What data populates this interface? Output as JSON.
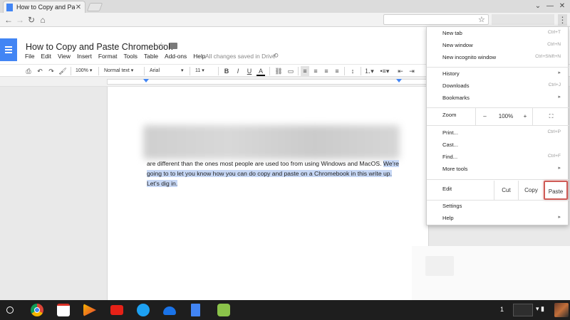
{
  "browser": {
    "tab_title": "How to Copy and Paste",
    "tab_close": "✕",
    "window_controls": [
      "⌄",
      "—",
      "✕"
    ],
    "nav_icons": [
      "back-arrow-icon",
      "forward-arrow-icon",
      "reload-icon",
      "home-icon"
    ],
    "menu_icon": "⋮"
  },
  "docs": {
    "title": "How to Copy and Paste Chromebook",
    "menu": [
      "File",
      "Edit",
      "View",
      "Insert",
      "Format",
      "Tools",
      "Table",
      "Add-ons",
      "Help"
    ],
    "save_status": "All changes saved in Drive",
    "toolbar": {
      "zoom": "100%",
      "style": "Normal text",
      "font": "Arial",
      "size": "11"
    },
    "body": {
      "plain": "are different than the ones most people are used too from using Windows and MacOS.",
      "highlight_1": "We're",
      "highlight_2": "going to to let you know how you can do copy and paste on a Chromebook in this write up.",
      "highlight_3": "Let's dig in."
    }
  },
  "chrome_menu": {
    "group1": [
      {
        "label": "New tab",
        "shortcut": "Ctrl+T"
      },
      {
        "label": "New window",
        "shortcut": "Ctrl+N"
      },
      {
        "label": "New incognito window",
        "shortcut": "Ctrl+Shift+N"
      }
    ],
    "group2": [
      {
        "label": "History",
        "arrow": "▸"
      },
      {
        "label": "Downloads",
        "shortcut": "Ctrl+J"
      },
      {
        "label": "Bookmarks",
        "arrow": "▸"
      }
    ],
    "zoom": {
      "label": "Zoom",
      "minus": "–",
      "value": "100%",
      "plus": "+",
      "fullscreen": "⛶"
    },
    "group3": [
      {
        "label": "Print...",
        "shortcut": "Ctrl+P"
      },
      {
        "label": "Cast..."
      },
      {
        "label": "Find...",
        "shortcut": "Ctrl+F"
      },
      {
        "label": "More tools",
        "arrow": "▸"
      }
    ],
    "edit": {
      "label": "Edit",
      "cut": "Cut",
      "copy": "Copy",
      "paste": "Paste"
    },
    "group4": [
      {
        "label": "Settings"
      },
      {
        "label": "Help",
        "arrow": "▸"
      }
    ]
  },
  "shelf": {
    "tray_number": "1",
    "apps": [
      "chrome-icon",
      "gmail-icon",
      "play-store-icon",
      "youtube-icon",
      "camera-icon",
      "cloud-icon",
      "docs-icon",
      "android-app-icon"
    ],
    "colors": {
      "chrome": "#db4437",
      "gmail": "#d93025",
      "play": "#f4b400",
      "youtube": "#e62117",
      "camera": "#1da1f2",
      "cloud": "#1a73e8",
      "docs": "#4285f4",
      "android": "#8bc34a"
    }
  },
  "colors": {
    "accent": "#4285f4",
    "highlight": "#c7d8f6",
    "paste_border": "#cf5b56"
  }
}
